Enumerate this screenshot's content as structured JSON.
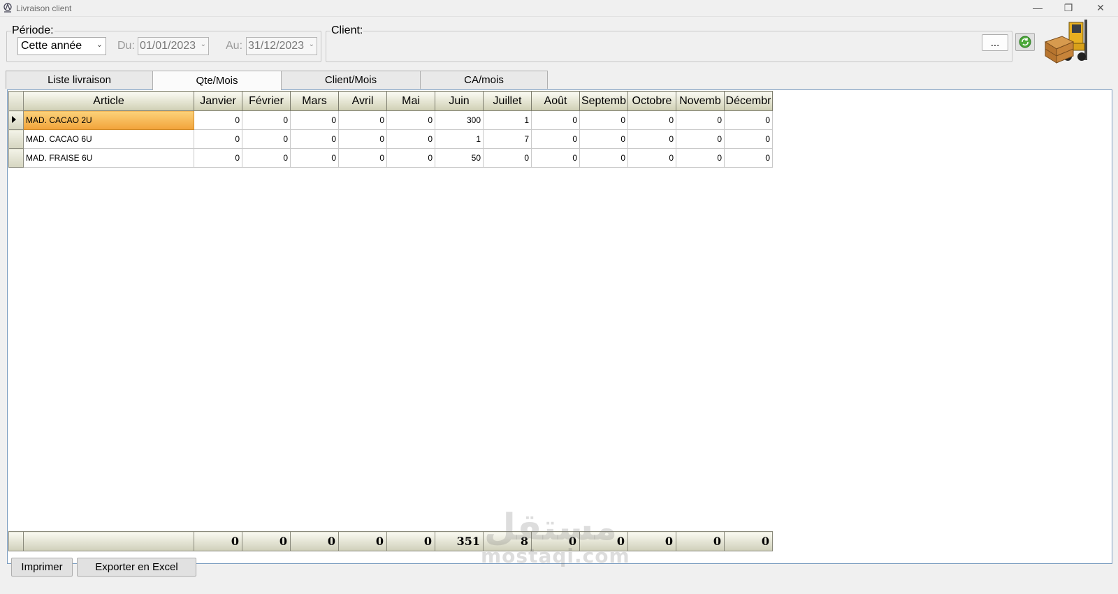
{
  "window": {
    "title": "Livraison client",
    "minimize": "—",
    "maximize": "❐",
    "close": "✕"
  },
  "periode": {
    "label": "Période:",
    "selected": "Cette année",
    "du_label": "Du:",
    "du_value": "01/01/2023",
    "au_label": "Au:",
    "au_value": "31/12/2023"
  },
  "client": {
    "label": "Client:",
    "browse_label": "..."
  },
  "tabs": [
    {
      "label": "Liste livraison"
    },
    {
      "label": "Qte/Mois"
    },
    {
      "label": "Client/Mois"
    },
    {
      "label": "CA/mois"
    }
  ],
  "grid": {
    "columns": [
      "Article",
      "Janvier",
      "Février",
      "Mars",
      "Avril",
      "Mai",
      "Juin",
      "Juillet",
      "Août",
      "Septemb",
      "Octobre",
      "Novemb",
      "Décembr"
    ],
    "rows": [
      {
        "article": "MAD. CACAO 2U",
        "values": [
          "0",
          "0",
          "0",
          "0",
          "0",
          "300",
          "1",
          "0",
          "0",
          "0",
          "0",
          "0"
        ]
      },
      {
        "article": "MAD. CACAO 6U",
        "values": [
          "0",
          "0",
          "0",
          "0",
          "0",
          "1",
          "7",
          "0",
          "0",
          "0",
          "0",
          "0"
        ]
      },
      {
        "article": "MAD. FRAISE 6U",
        "values": [
          "0",
          "0",
          "0",
          "0",
          "0",
          "50",
          "0",
          "0",
          "0",
          "0",
          "0",
          "0"
        ]
      }
    ],
    "totals": [
      "0",
      "0",
      "0",
      "0",
      "0",
      "351",
      "8",
      "0",
      "0",
      "0",
      "0",
      "0"
    ]
  },
  "footer": {
    "print_label": "Imprimer",
    "export_label": "Exporter en Excel"
  },
  "watermark": {
    "arabic": "مستقل",
    "latin": "mostaqi.com"
  },
  "colors": {
    "selection": "#f2a33a",
    "header": "#e3e3d0"
  }
}
